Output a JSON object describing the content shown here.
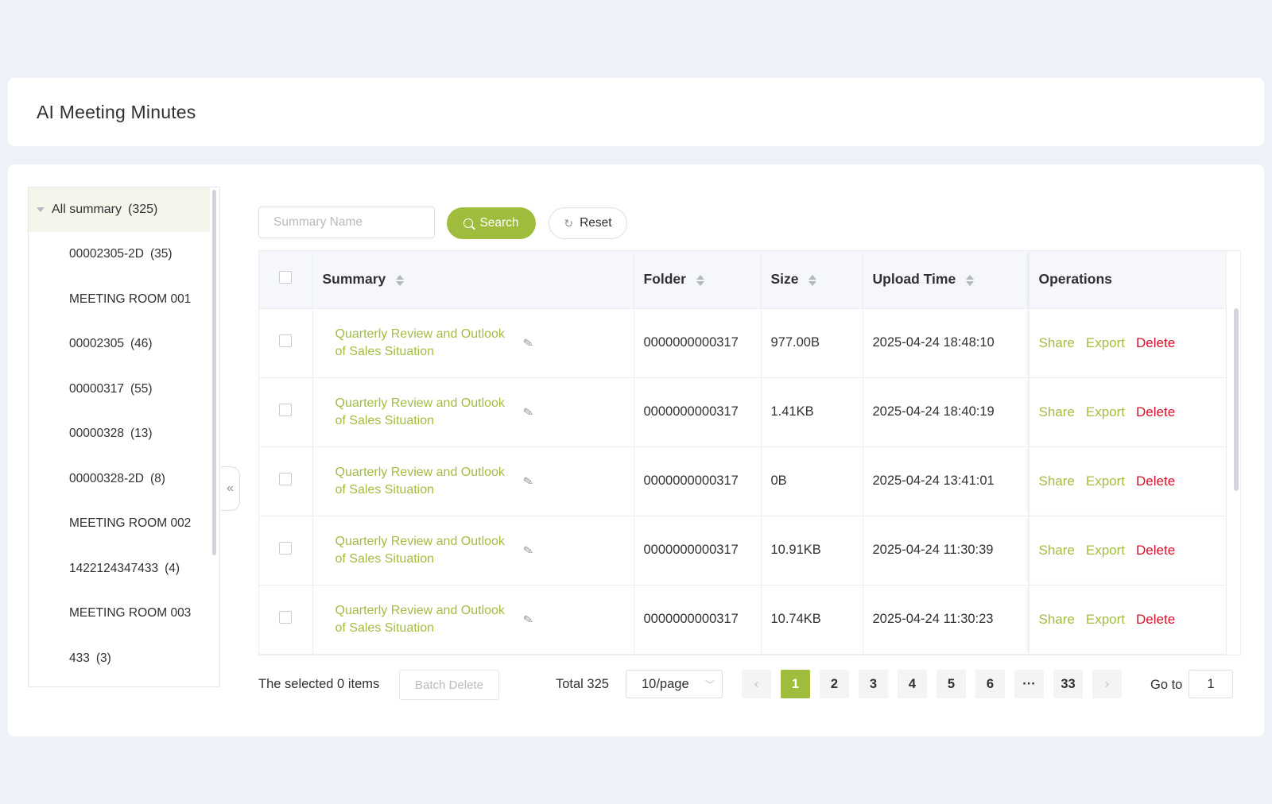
{
  "page": {
    "title": "AI Meeting Minutes"
  },
  "tree": {
    "root": {
      "label": "All summary",
      "count": "(325)"
    },
    "items": [
      {
        "label": "00002305-2D",
        "count": "(35)"
      },
      {
        "label": "MEETING ROOM 001",
        "count": ""
      },
      {
        "label": "00002305",
        "count": "(46)"
      },
      {
        "label": "00000317",
        "count": "(55)"
      },
      {
        "label": "00000328",
        "count": "(13)"
      },
      {
        "label": "00000328-2D",
        "count": "(8)"
      },
      {
        "label": "MEETING ROOM 002",
        "count": ""
      },
      {
        "label": "1422124347433",
        "count": "(4)"
      },
      {
        "label": "MEETING ROOM 003",
        "count": ""
      },
      {
        "label": "433",
        "count": "(3)"
      }
    ],
    "collapse_icon": "«"
  },
  "toolbar": {
    "search_placeholder": "Summary Name",
    "search_value": "",
    "search_label": "Search",
    "reset_label": "Reset"
  },
  "table": {
    "headers": {
      "summary": "Summary",
      "folder": "Folder",
      "size": "Size",
      "upload_time": "Upload Time",
      "operations": "Operations"
    },
    "rows": [
      {
        "summary": "Quarterly Review and Outlook of Sales Situation",
        "folder": "0000000000317",
        "size": "977.00B",
        "upload_time": "2025-04-24 18:48:10"
      },
      {
        "summary": "Quarterly Review and Outlook of Sales Situation",
        "folder": "0000000000317",
        "size": "1.41KB",
        "upload_time": "2025-04-24 18:40:19"
      },
      {
        "summary": "Quarterly Review and Outlook of Sales Situation",
        "folder": "0000000000317",
        "size": "0B",
        "upload_time": "2025-04-24 13:41:01"
      },
      {
        "summary": "Quarterly Review and Outlook of Sales Situation",
        "folder": "0000000000317",
        "size": "10.91KB",
        "upload_time": "2025-04-24 11:30:39"
      },
      {
        "summary": "Quarterly Review and Outlook of Sales Situation",
        "folder": "0000000000317",
        "size": "10.74KB",
        "upload_time": "2025-04-24 11:30:23"
      }
    ],
    "operations": {
      "share": "Share",
      "export": "Export",
      "delete": "Delete"
    }
  },
  "footer": {
    "selected_text": "The selected 0 items",
    "batch_delete": "Batch Delete",
    "total": "Total 325",
    "page_size": "10/page",
    "pages": [
      "1",
      "2",
      "3",
      "4",
      "5",
      "6",
      "···",
      "33"
    ],
    "current_page": "1",
    "prev_icon": "‹",
    "next_icon": "›",
    "goto_label": "Go to",
    "goto_value": "1"
  },
  "colors": {
    "accent": "#9fbc3c",
    "link": "#a2bd40",
    "danger": "#d8102b",
    "background": "#eef1f8"
  }
}
